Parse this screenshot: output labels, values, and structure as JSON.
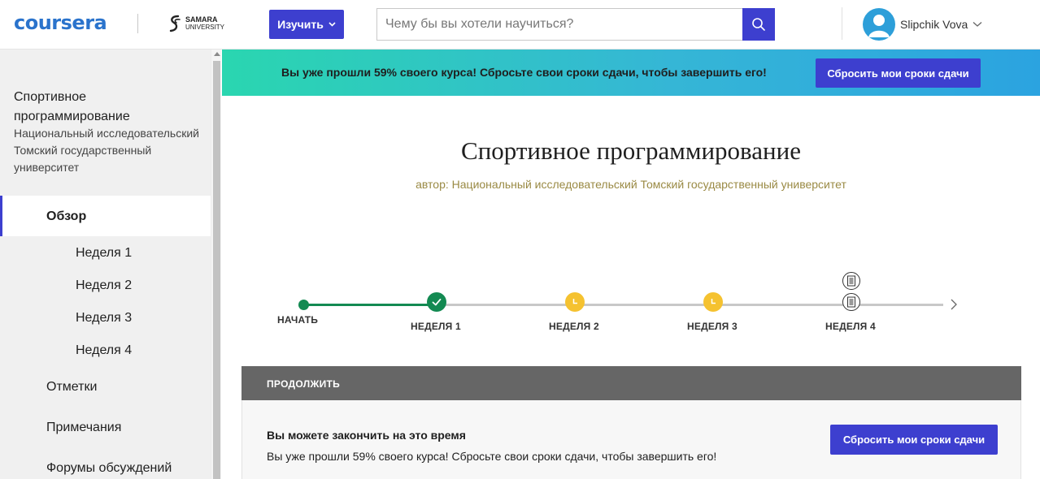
{
  "header": {
    "logo": "coursera",
    "partner": {
      "line1": "SAMARA",
      "line2": "UNIVERSITY"
    },
    "explore_label": "Изучить",
    "search_placeholder": "Чему бы вы хотели научиться?",
    "user_name": "Slipchik Vova"
  },
  "sidebar": {
    "course_title": "Спортивное программирование",
    "course_university": "Национальный исследовательский Томский государственный университет",
    "items": [
      {
        "label": "Обзор",
        "active": true
      },
      {
        "label": "Неделя 1"
      },
      {
        "label": "Неделя 2"
      },
      {
        "label": "Неделя 3"
      },
      {
        "label": "Неделя 4"
      },
      {
        "label": "Отметки"
      },
      {
        "label": "Примечания"
      },
      {
        "label": "Форумы обсуждений"
      }
    ]
  },
  "banner": {
    "text": "Вы уже прошли 59% своего курса! Сбросьте свои сроки сдачи, чтобы завершить его!",
    "button": "Сбросить мои сроки сдачи"
  },
  "main": {
    "title": "Спортивное программирование",
    "author": "автор: Национальный исследовательский Томский государственный университет"
  },
  "timeline": {
    "start_label": "НАЧАТЬ",
    "weeks": [
      {
        "label": "НЕДЕЛЯ 1",
        "status": "completed"
      },
      {
        "label": "НЕДЕЛЯ 2",
        "status": "pending"
      },
      {
        "label": "НЕДЕЛЯ 3",
        "status": "pending"
      },
      {
        "label": "НЕДЕЛЯ 4",
        "status": "assignments"
      }
    ]
  },
  "continue_panel": {
    "header": "ПРОДОЛЖИТЬ",
    "title": "Вы можете закончить на это время",
    "text": "Вы уже прошли 59% своего курса! Сбросьте свои сроки сдачи, чтобы завершить его!",
    "button": "Сбросить мои сроки сдачи"
  },
  "colors": {
    "brand": "#2a73cc",
    "accent": "#3d3fcf",
    "success": "#138a52",
    "pending": "#f5c230",
    "author_text": "#9a8a44"
  }
}
